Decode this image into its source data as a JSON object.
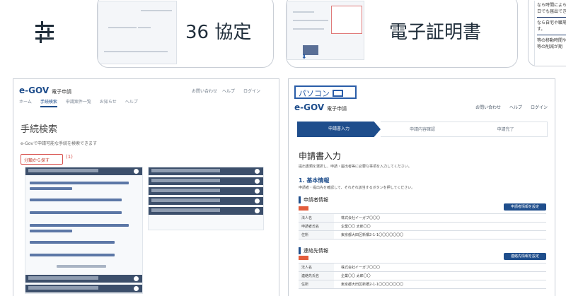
{
  "filter_icon": "sliders-icon",
  "chips": [
    {
      "label": "36 協定"
    },
    {
      "label": "電子証明書"
    }
  ],
  "chip_c_snippets": [
    "なら時間によら",
    "日でも届出でき",
    "なら自宅や職場",
    "す。",
    "等の移動時間や",
    "等の削減が期"
  ],
  "left_panel": {
    "logo": "e-GOV",
    "logo_sub": "電子申請",
    "topright": [
      "お問い合わせ",
      "ヘルプ",
      "ログイン"
    ],
    "nav": [
      "ホーム",
      "手続検索",
      "申請案件一覧",
      "お知らせ",
      "ヘルプ"
    ],
    "heading": "手続検索",
    "description": "e-Govで申請可能な手続を検索できます",
    "tab": "分類から探す",
    "tab_note": "(1)"
  },
  "right_panel": {
    "badge": "パソコン",
    "logo": "e-GOV",
    "logo_sub": "電子申請",
    "topright": [
      "お問い合わせ",
      "ヘルプ",
      "ログイン"
    ],
    "steps": [
      "申請書入力",
      "申請内容確認",
      "申請完了"
    ],
    "heading": "申請書入力",
    "description": "提出書類を選択し、申請・届出者等に必要な事項を入力してください。",
    "section": "1. 基本情報",
    "section_desc": "申請者・提出先を確認して、それぞれ該当するボタンを押してください。",
    "applicant_title": "申請者情報",
    "applicant_button": "申請者情報を設定",
    "applicant_rows": [
      {
        "k": "法人名",
        "v": "株式会社イーガブ〇〇〇"
      },
      {
        "k": "申請者氏名",
        "v": "企業〇〇 太郎〇〇"
      },
      {
        "k": "住所",
        "v": "東京都大田区新橋2-1-1〇〇〇〇〇〇〇"
      }
    ],
    "contact_title": "連絡先情報",
    "contact_button": "連絡先情報を設定",
    "contact_rows": [
      {
        "k": "法人名",
        "v": "株式会社イーガブ〇〇〇"
      },
      {
        "k": "連絡先氏名",
        "v": "企業〇〇 太郎〇〇"
      },
      {
        "k": "住所",
        "v": "東京都大田区新橋2-1-1〇〇〇〇〇〇〇"
      }
    ]
  }
}
